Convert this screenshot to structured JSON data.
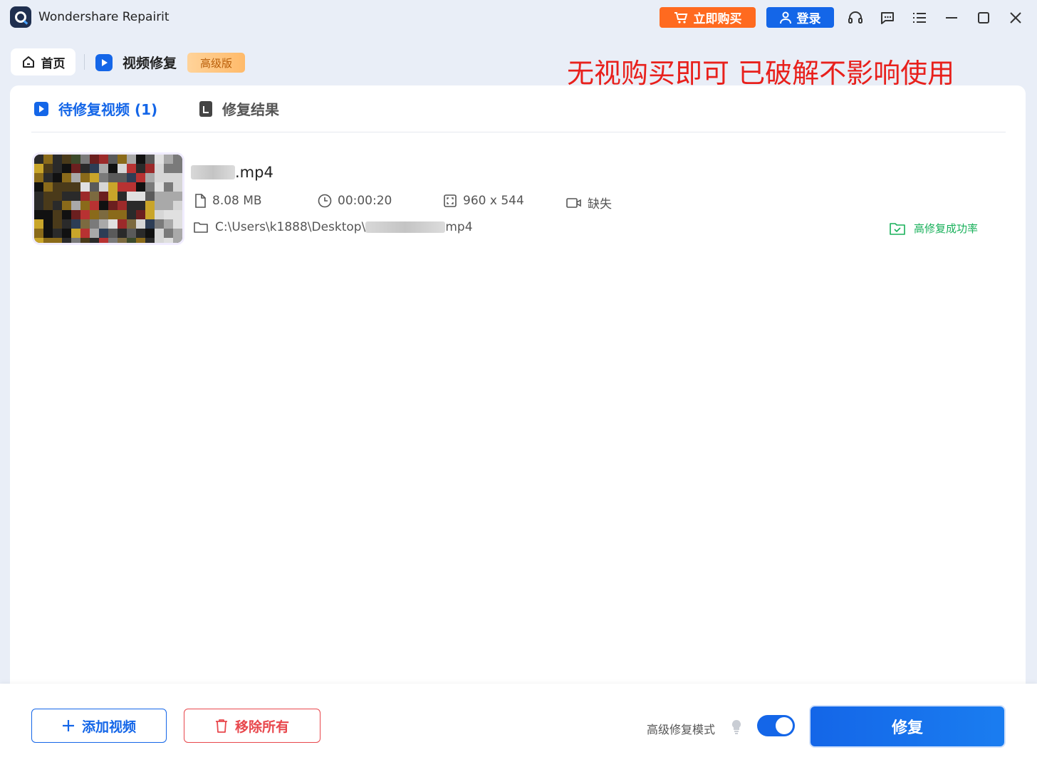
{
  "app": {
    "title": "Wondershare Repairit"
  },
  "header": {
    "buy_label": "立即购买",
    "login_label": "登录"
  },
  "nav": {
    "home_label": "首页",
    "module_title": "视频修复",
    "badge": "高级版"
  },
  "overlay_text": "无视购买即可 已破解不影响使用",
  "tabs": {
    "pending_label": "待修复视频 (1)",
    "result_label": "修复结果"
  },
  "file": {
    "name_suffix": ".mp4",
    "size": "8.08 MB",
    "duration": "00:00:20",
    "resolution": "960 x 544",
    "camera": "缺失",
    "path_prefix": "C:\\Users\\k1888\\Desktop\\",
    "path_suffix": "mp4",
    "status": "高修复成功率"
  },
  "footer": {
    "add_label": "添加视频",
    "remove_label": "移除所有",
    "mode_label": "高级修复模式",
    "repair_label": "修复",
    "advanced_mode_enabled": true
  },
  "colors": {
    "accent": "#1466e8",
    "buy": "#ff6a1f",
    "danger": "#e8474c",
    "success": "#18b05a",
    "overlay": "#e8201c"
  }
}
